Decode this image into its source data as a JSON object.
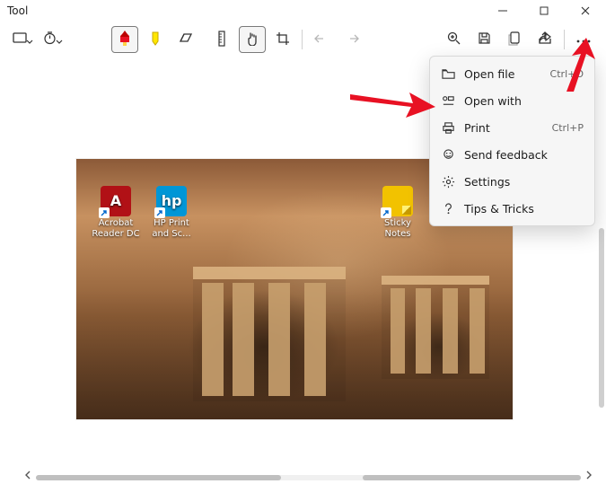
{
  "window": {
    "title": "Tool"
  },
  "toolbar": {
    "selection_mode_icon": "rectangle-select-icon",
    "delay_icon": "timer-icon",
    "pen_icon": "pen-icon",
    "highlighter_icon": "highlighter-icon",
    "eraser_icon": "eraser-icon",
    "ruler_icon": "ruler-icon",
    "touch_writing_icon": "touch-writing-icon",
    "crop_icon": "crop-icon",
    "undo_icon": "undo-icon",
    "redo_icon": "redo-icon",
    "zoom_icon": "zoom-icon",
    "save_icon": "save-icon",
    "copy_icon": "copy-icon",
    "share_icon": "share-icon",
    "more_icon": "more-icon"
  },
  "menu": {
    "items": [
      {
        "icon": "folder-open-icon",
        "label": "Open file",
        "shortcut": "Ctrl+O"
      },
      {
        "icon": "open-with-icon",
        "label": "Open with",
        "shortcut": ""
      },
      {
        "icon": "printer-icon",
        "label": "Print",
        "shortcut": "Ctrl+P"
      },
      {
        "icon": "feedback-icon",
        "label": "Send feedback",
        "shortcut": ""
      },
      {
        "icon": "gear-icon",
        "label": "Settings",
        "shortcut": ""
      },
      {
        "icon": "help-icon",
        "label": "Tips & Tricks",
        "shortcut": ""
      }
    ]
  },
  "screenshot": {
    "desktop_icons": [
      {
        "name": "acrobat-reader",
        "label": "Acrobat Reader DC"
      },
      {
        "name": "hp-print-scan",
        "label": "HP Print and Sc..."
      },
      {
        "name": "sticky-notes",
        "label": "Sticky Notes"
      }
    ]
  },
  "colors": {
    "annotation_arrow": "#e81123",
    "pen_selected_border": "#7a7a7a"
  }
}
